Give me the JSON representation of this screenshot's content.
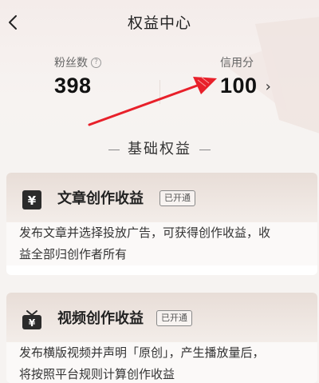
{
  "header": {
    "title": "权益中心"
  },
  "stats": {
    "fans": {
      "label": "粉丝数",
      "value": "398"
    },
    "credit": {
      "label": "信用分",
      "value": "100"
    }
  },
  "section": {
    "title": "基础权益"
  },
  "cards": [
    {
      "name": "文章创作收益",
      "badge": "已开通",
      "desc_line1": "发布文章并选择投放广告，可获得创作收益，收",
      "desc_line2": "益全部归创作者所有",
      "icon": "yen-icon"
    },
    {
      "name": "视频创作收益",
      "badge": "已开通",
      "desc_line1": "发布横版视频并声明「原创」，产生播放量后，",
      "desc_line2": "将按照平台规则计算创作收益",
      "icon": "tv-yen-icon"
    }
  ],
  "colors": {
    "arrow": "#e8202a",
    "card_top": "#e8ddd7",
    "background": "#f6f3f1"
  }
}
